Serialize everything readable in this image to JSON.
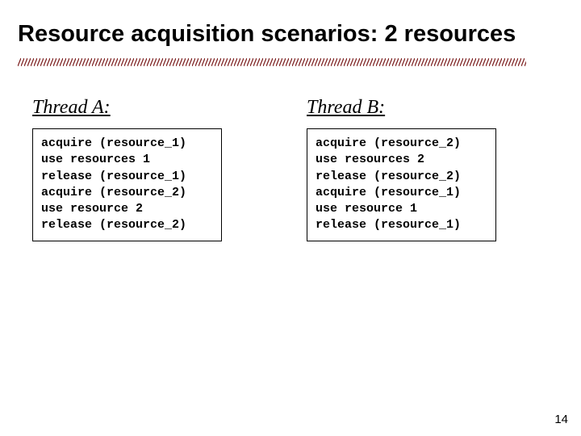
{
  "slide": {
    "title": "Resource acquisition scenarios: 2 resources",
    "page_number": "14"
  },
  "threadA": {
    "header": "Thread A:",
    "code": "acquire (resource_1)\nuse resources 1\nrelease (resource_1)\nacquire (resource_2)\nuse resource 2\nrelease (resource_2)"
  },
  "threadB": {
    "header": "Thread B:",
    "code": "acquire (resource_2)\nuse resources 2\nrelease (resource_2)\nacquire (resource_1)\nuse resource 1\nrelease (resource_1)"
  }
}
